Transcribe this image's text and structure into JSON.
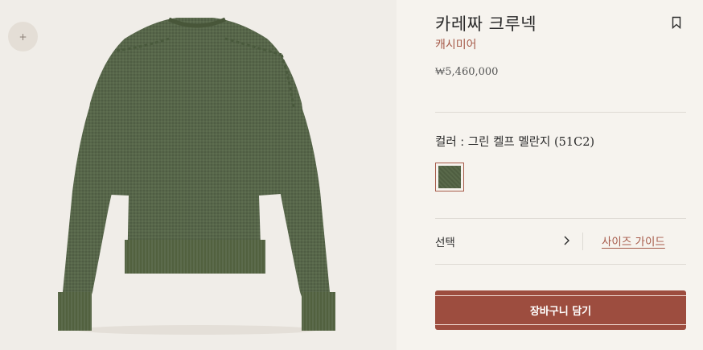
{
  "gallery": {
    "zoom_button": "+",
    "image_icon": "sweater-image"
  },
  "product": {
    "name": "카레짜 크루넥",
    "material": "캐시미어",
    "price": "₩5,460,000",
    "bookmark_icon": "bookmark-icon"
  },
  "color": {
    "label": "컬러 : 그린 켈프 멜란지 ",
    "code": "(51C2)",
    "swatch_color": "#56664a"
  },
  "size": {
    "select_label": "선택",
    "guide_label": "사이즈 가이드"
  },
  "cart": {
    "button_label": "장바구니 담기",
    "button_color": "#9d4d3f"
  },
  "accent_color": "#a65a49"
}
